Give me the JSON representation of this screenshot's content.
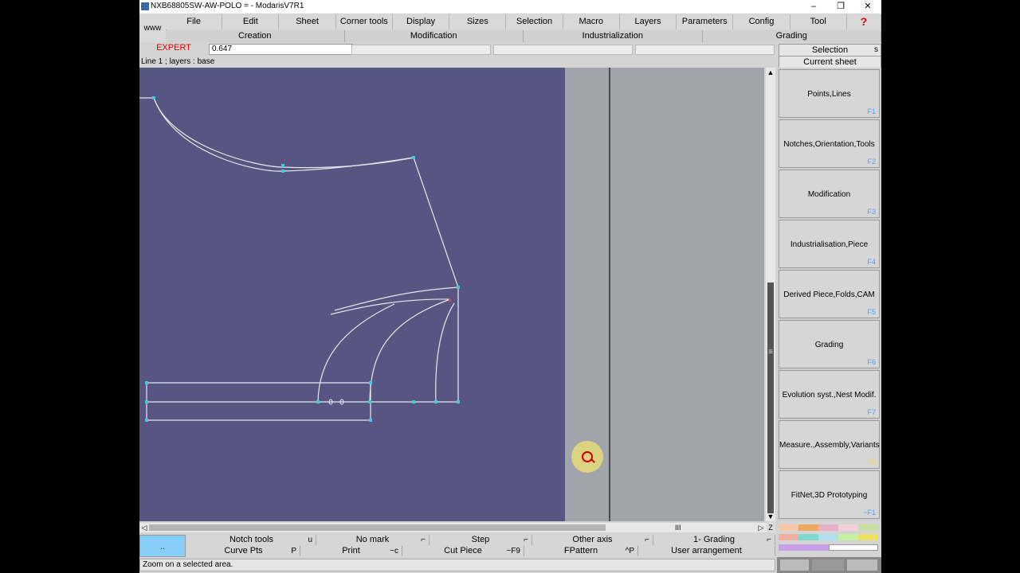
{
  "window": {
    "title": "NXB68805SW-AW-POLO = - ModarisV7R1",
    "minimize": "–",
    "maximize": "❐",
    "close": "✕"
  },
  "menu": [
    "File",
    "Edit",
    "Sheet",
    "Corner tools",
    "Display",
    "Sizes",
    "Selection",
    "Macro",
    "Layers",
    "Parameters",
    "Config",
    "Tool",
    "?"
  ],
  "www_label": "www",
  "submenu": [
    "Creation",
    "Modification",
    "Industrialization",
    "Grading"
  ],
  "mode_label": "EXPERT",
  "value_field": "0.647",
  "selection": {
    "label": "Selection",
    "key": "s"
  },
  "current_sheet": "Current sheet",
  "line_info": "Line 1   ;    layers :  base",
  "right_panel": [
    {
      "label": "Points,Lines",
      "key": "F1"
    },
    {
      "label": "Notches,Orientation,Tools",
      "key": "F2"
    },
    {
      "label": "Modification",
      "key": "F3"
    },
    {
      "label": "Industrialisation,Piece",
      "key": "F4"
    },
    {
      "label": "Derived Piece,Folds,CAM",
      "key": "F5"
    },
    {
      "label": "Grading",
      "key": "F6"
    },
    {
      "label": "Evolution syst.,Nest Modif.",
      "key": "F7"
    },
    {
      "label": "Measure.,Assembly,Variants",
      "key": "F8"
    },
    {
      "label": "FitNet,3D Prototyping",
      "key": "~F1"
    }
  ],
  "scroll": {
    "up": "▲",
    "down": "▼",
    "left": "◁",
    "right": "▷",
    "zoom": "Z",
    "grip": "III",
    "vgrip": "≡"
  },
  "bottom_toolbar": {
    "blue_button": "..",
    "row1": [
      {
        "label": "Notch tools",
        "key": "u"
      },
      {
        "label": "No mark",
        "key": "⌐"
      },
      {
        "label": "Step",
        "key": "⌐"
      },
      {
        "label": "Other axis",
        "key": "⌐"
      },
      {
        "label": "1- Grading",
        "key": "⌐"
      }
    ],
    "row2": [
      {
        "label": "Curve Pts",
        "key": "P"
      },
      {
        "label": "Print",
        "key": "~c"
      },
      {
        "label": "Cut Piece",
        "key": "~F9"
      },
      {
        "label": "FPattern",
        "key": "^P"
      },
      {
        "label": "User arrangement",
        "key": ""
      }
    ]
  },
  "status_text": "Zoom on a selected area.",
  "palette": {
    "row1": [
      "#f5c6a8",
      "#f0a860",
      "#e8b0c8",
      "#f2d0d8",
      "#c8e0a0"
    ],
    "row2": [
      "#f0b0a0",
      "#80d8d0",
      "#b0e0f0",
      "#c8f0a0",
      "#f0e060"
    ],
    "row3": [
      "#c8a0e8",
      "#ffffff"
    ]
  },
  "colors": {
    "canvas": "#575581",
    "expert": "#e00000",
    "pattern_line": "#e8e8f0",
    "point": "#40c8e0"
  }
}
